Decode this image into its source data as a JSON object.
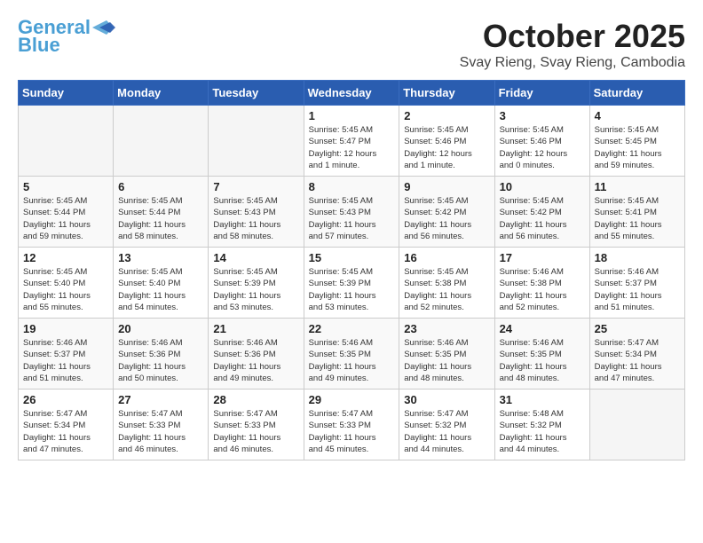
{
  "header": {
    "logo_general": "General",
    "logo_blue": "Blue",
    "month_title": "October 2025",
    "subtitle": "Svay Rieng, Svay Rieng, Cambodia"
  },
  "weekdays": [
    "Sunday",
    "Monday",
    "Tuesday",
    "Wednesday",
    "Thursday",
    "Friday",
    "Saturday"
  ],
  "weeks": [
    [
      {
        "day": "",
        "info": ""
      },
      {
        "day": "",
        "info": ""
      },
      {
        "day": "",
        "info": ""
      },
      {
        "day": "1",
        "info": "Sunrise: 5:45 AM\nSunset: 5:47 PM\nDaylight: 12 hours\nand 1 minute."
      },
      {
        "day": "2",
        "info": "Sunrise: 5:45 AM\nSunset: 5:46 PM\nDaylight: 12 hours\nand 1 minute."
      },
      {
        "day": "3",
        "info": "Sunrise: 5:45 AM\nSunset: 5:46 PM\nDaylight: 12 hours\nand 0 minutes."
      },
      {
        "day": "4",
        "info": "Sunrise: 5:45 AM\nSunset: 5:45 PM\nDaylight: 11 hours\nand 59 minutes."
      }
    ],
    [
      {
        "day": "5",
        "info": "Sunrise: 5:45 AM\nSunset: 5:44 PM\nDaylight: 11 hours\nand 59 minutes."
      },
      {
        "day": "6",
        "info": "Sunrise: 5:45 AM\nSunset: 5:44 PM\nDaylight: 11 hours\nand 58 minutes."
      },
      {
        "day": "7",
        "info": "Sunrise: 5:45 AM\nSunset: 5:43 PM\nDaylight: 11 hours\nand 58 minutes."
      },
      {
        "day": "8",
        "info": "Sunrise: 5:45 AM\nSunset: 5:43 PM\nDaylight: 11 hours\nand 57 minutes."
      },
      {
        "day": "9",
        "info": "Sunrise: 5:45 AM\nSunset: 5:42 PM\nDaylight: 11 hours\nand 56 minutes."
      },
      {
        "day": "10",
        "info": "Sunrise: 5:45 AM\nSunset: 5:42 PM\nDaylight: 11 hours\nand 56 minutes."
      },
      {
        "day": "11",
        "info": "Sunrise: 5:45 AM\nSunset: 5:41 PM\nDaylight: 11 hours\nand 55 minutes."
      }
    ],
    [
      {
        "day": "12",
        "info": "Sunrise: 5:45 AM\nSunset: 5:40 PM\nDaylight: 11 hours\nand 55 minutes."
      },
      {
        "day": "13",
        "info": "Sunrise: 5:45 AM\nSunset: 5:40 PM\nDaylight: 11 hours\nand 54 minutes."
      },
      {
        "day": "14",
        "info": "Sunrise: 5:45 AM\nSunset: 5:39 PM\nDaylight: 11 hours\nand 53 minutes."
      },
      {
        "day": "15",
        "info": "Sunrise: 5:45 AM\nSunset: 5:39 PM\nDaylight: 11 hours\nand 53 minutes."
      },
      {
        "day": "16",
        "info": "Sunrise: 5:45 AM\nSunset: 5:38 PM\nDaylight: 11 hours\nand 52 minutes."
      },
      {
        "day": "17",
        "info": "Sunrise: 5:46 AM\nSunset: 5:38 PM\nDaylight: 11 hours\nand 52 minutes."
      },
      {
        "day": "18",
        "info": "Sunrise: 5:46 AM\nSunset: 5:37 PM\nDaylight: 11 hours\nand 51 minutes."
      }
    ],
    [
      {
        "day": "19",
        "info": "Sunrise: 5:46 AM\nSunset: 5:37 PM\nDaylight: 11 hours\nand 51 minutes."
      },
      {
        "day": "20",
        "info": "Sunrise: 5:46 AM\nSunset: 5:36 PM\nDaylight: 11 hours\nand 50 minutes."
      },
      {
        "day": "21",
        "info": "Sunrise: 5:46 AM\nSunset: 5:36 PM\nDaylight: 11 hours\nand 49 minutes."
      },
      {
        "day": "22",
        "info": "Sunrise: 5:46 AM\nSunset: 5:35 PM\nDaylight: 11 hours\nand 49 minutes."
      },
      {
        "day": "23",
        "info": "Sunrise: 5:46 AM\nSunset: 5:35 PM\nDaylight: 11 hours\nand 48 minutes."
      },
      {
        "day": "24",
        "info": "Sunrise: 5:46 AM\nSunset: 5:35 PM\nDaylight: 11 hours\nand 48 minutes."
      },
      {
        "day": "25",
        "info": "Sunrise: 5:47 AM\nSunset: 5:34 PM\nDaylight: 11 hours\nand 47 minutes."
      }
    ],
    [
      {
        "day": "26",
        "info": "Sunrise: 5:47 AM\nSunset: 5:34 PM\nDaylight: 11 hours\nand 47 minutes."
      },
      {
        "day": "27",
        "info": "Sunrise: 5:47 AM\nSunset: 5:33 PM\nDaylight: 11 hours\nand 46 minutes."
      },
      {
        "day": "28",
        "info": "Sunrise: 5:47 AM\nSunset: 5:33 PM\nDaylight: 11 hours\nand 46 minutes."
      },
      {
        "day": "29",
        "info": "Sunrise: 5:47 AM\nSunset: 5:33 PM\nDaylight: 11 hours\nand 45 minutes."
      },
      {
        "day": "30",
        "info": "Sunrise: 5:47 AM\nSunset: 5:32 PM\nDaylight: 11 hours\nand 44 minutes."
      },
      {
        "day": "31",
        "info": "Sunrise: 5:48 AM\nSunset: 5:32 PM\nDaylight: 11 hours\nand 44 minutes."
      },
      {
        "day": "",
        "info": ""
      }
    ]
  ]
}
